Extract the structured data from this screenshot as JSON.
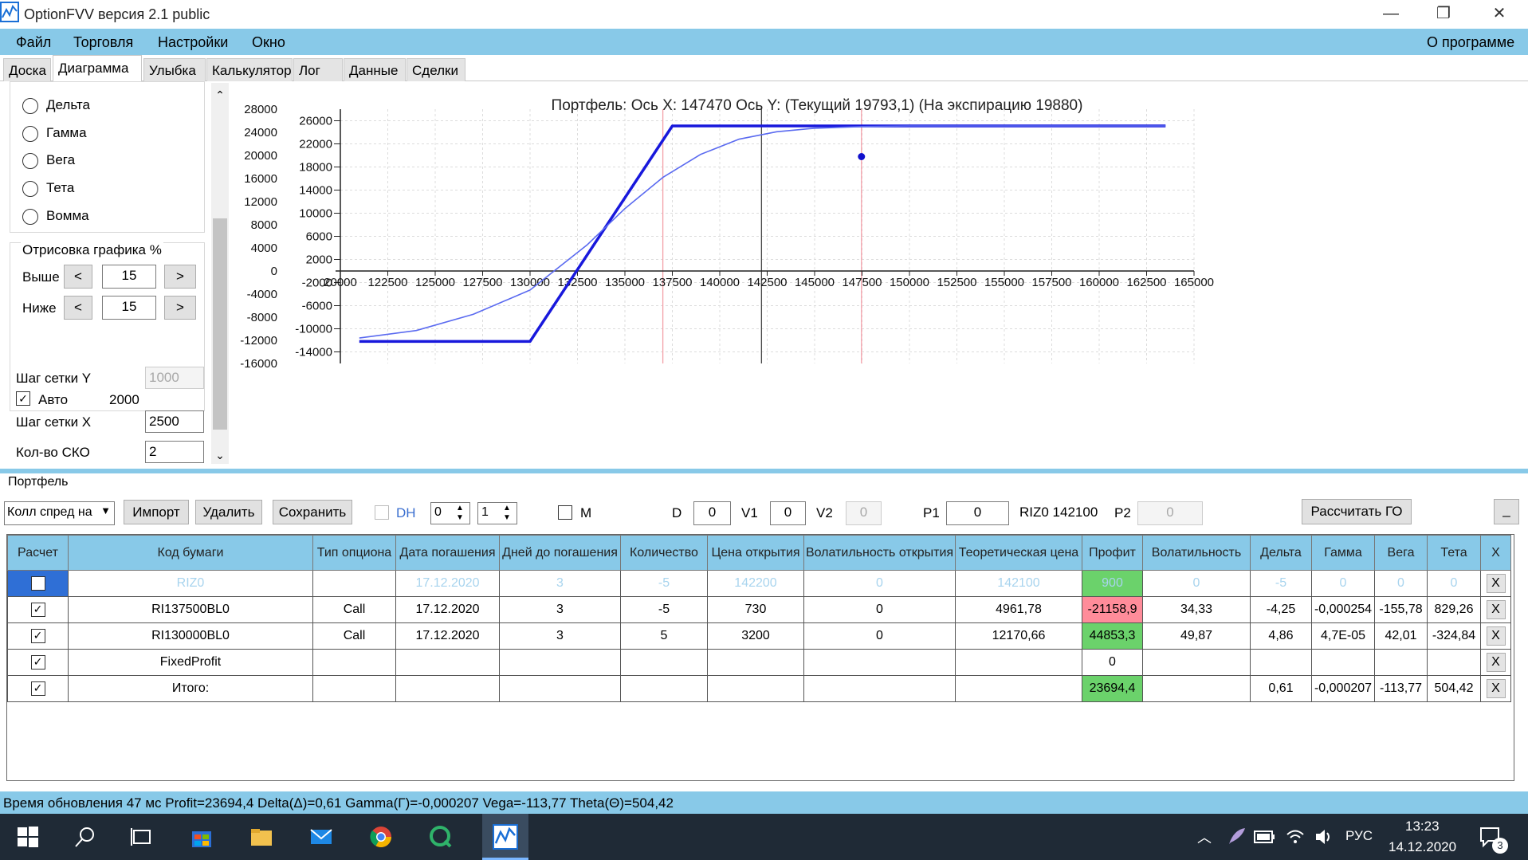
{
  "window": {
    "title": "OptionFVV версия 2.1 public",
    "minimize": "—",
    "restore": "❐",
    "close": "✕"
  },
  "menu": {
    "items": [
      "Файл",
      "Торговля",
      "Настройки",
      "Окно"
    ],
    "about": "О программе"
  },
  "tabs": [
    "Доска",
    "Диаграмма",
    "Улыбка",
    "Калькулятор",
    "Лог",
    "Данные",
    "Сделки"
  ],
  "left_panel": {
    "radios": [
      "Дельта",
      "Гамма",
      "Вега",
      "Тета",
      "Вомма"
    ],
    "draw_group_label": "Отрисовка графика %",
    "above_label": "Выше",
    "above_value": "15",
    "below_label": "Ниже",
    "below_value": "15",
    "prev_btn": "<",
    "next_btn": ">",
    "grid_y_label": "Шаг сетки Y",
    "grid_y_value": "1000",
    "auto_label": "Авто",
    "auto_value": "2000",
    "grid_x_label": "Шаг сетки X",
    "grid_x_value": "2500",
    "sko_label": "Кол-во СКО",
    "sko_value": "2",
    "scroll_up": "⌃",
    "scroll_down": "⌄"
  },
  "chart_data": {
    "type": "line",
    "title": "Портфель: Ось X: 147470 Ось Y:  (Текущий 19793,1)  (На экспирацию 19880)",
    "xlim": [
      120000,
      165000
    ],
    "ylim": [
      -16000,
      28000
    ],
    "x_ticks": [
      "20000",
      "122500",
      "125000",
      "127500",
      "130000",
      "132500",
      "135000",
      "137500",
      "140000",
      "142500",
      "145000",
      "147500",
      "150000",
      "152500",
      "155000",
      "157500",
      "160000",
      "162500",
      "165000"
    ],
    "x_tick_values": [
      120000,
      122500,
      125000,
      127500,
      130000,
      132500,
      135000,
      137500,
      140000,
      142500,
      145000,
      147500,
      150000,
      152500,
      155000,
      157500,
      160000,
      162500,
      165000
    ],
    "y_ticks_left": [
      28000,
      24000,
      20000,
      16000,
      12000,
      8000,
      4000,
      0,
      -4000,
      -8000,
      -12000,
      -16000
    ],
    "y_ticks_right": [
      26000,
      22000,
      18000,
      14000,
      10000,
      6000,
      2000,
      -2000,
      -6000,
      -10000,
      -14000
    ],
    "grid": true,
    "vlines": [
      {
        "x": 137000,
        "color": "#f4a0a8"
      },
      {
        "x": 142200,
        "color": "#4a4a4a"
      },
      {
        "x": 147470,
        "color": "#f4a0a8"
      }
    ],
    "series": [
      {
        "color": "#1818dc",
        "x": [
          121000,
          130000,
          137500,
          163500
        ],
        "y": [
          -12200,
          -12200,
          25100,
          25100
        ]
      },
      {
        "color": "#5a6af0",
        "x": [
          121000,
          124000,
          127000,
          130000,
          133000,
          135000,
          137000,
          139000,
          141000,
          143000,
          145000,
          147500,
          150000,
          155000,
          160000,
          163500
        ],
        "y": [
          -11600,
          -10300,
          -7500,
          -3300,
          4500,
          10800,
          16200,
          20200,
          22800,
          24100,
          24700,
          25000,
          25100,
          25100,
          25100,
          25100
        ]
      }
    ],
    "points": [
      {
        "x": 147470,
        "y": 19793,
        "color": "#1010cc"
      }
    ]
  },
  "portfolio": {
    "label": "Портфель",
    "strategy_select": "Колл спред на",
    "import_btn": "Импорт",
    "delete_btn": "Удалить",
    "save_btn": "Сохранить",
    "dh_label": "DH",
    "spin1": "0",
    "spin2": "1",
    "m_label": "M",
    "d_label": "D",
    "d_value": "0",
    "v1_label": "V1",
    "v1_value": "0",
    "v2_label": "V2",
    "v2_value": "0",
    "p1_label": "P1",
    "p1_value": "0",
    "riz_label": "RIZ0 142100",
    "p2_label": "P2",
    "p2_value": "0",
    "calc_go_btn": "Рассчитать ГО",
    "minimize_btn": "_"
  },
  "table": {
    "columns": [
      "Расчет",
      "Код бумаги",
      "Тип опциона",
      "Дата погашения",
      "Дней до погашения",
      "Количество",
      "Цена открытия",
      "Волатильность открытия",
      "Теоретическая цена",
      "Профит",
      "Волатильность",
      "Дельта",
      "Гамма",
      "Вега",
      "Тета",
      "X"
    ],
    "rows": [
      {
        "checked": false,
        "cells": [
          "RIZ0",
          "",
          "17.12.2020",
          "3",
          "-5",
          "142200",
          "0",
          "142100",
          "900",
          "0",
          "-5",
          "0",
          "0",
          "0"
        ],
        "profit_color": "green",
        "faded": true,
        "selected": true
      },
      {
        "checked": true,
        "cells": [
          "RI137500BL0",
          "Call",
          "17.12.2020",
          "3",
          "-5",
          "730",
          "0",
          "4961,78",
          "-21158,9",
          "34,33",
          "-4,25",
          "-0,000254",
          "-155,78",
          "829,26"
        ],
        "profit_color": "red"
      },
      {
        "checked": true,
        "cells": [
          "RI130000BL0",
          "Call",
          "17.12.2020",
          "3",
          "5",
          "3200",
          "0",
          "12170,66",
          "44853,3",
          "49,87",
          "4,86",
          "4,7E-05",
          "42,01",
          "-324,84"
        ],
        "profit_color": "green"
      },
      {
        "checked": true,
        "cells": [
          "FixedProfit",
          "",
          "",
          "",
          "",
          "",
          "",
          "",
          "0",
          "",
          "",
          "",
          "",
          ""
        ],
        "profit_color": "none"
      },
      {
        "checked": true,
        "cells": [
          "Итого:",
          "",
          "",
          "",
          "",
          "",
          "",
          "",
          "23694,4",
          "",
          "0,61",
          "-0,000207",
          "-113,77",
          "504,42"
        ],
        "profit_color": "green"
      }
    ],
    "x_label": "X"
  },
  "status": "Время обновления 47 мс  Profit=23694,4 Delta(Δ)=0,61 Gamma(Γ)=-0,000207 Vega=-113,77 Theta(Θ)=504,42",
  "taskbar": {
    "lang": "РУС",
    "time": "13:23",
    "date": "14.12.2020",
    "notif_count": "3"
  }
}
